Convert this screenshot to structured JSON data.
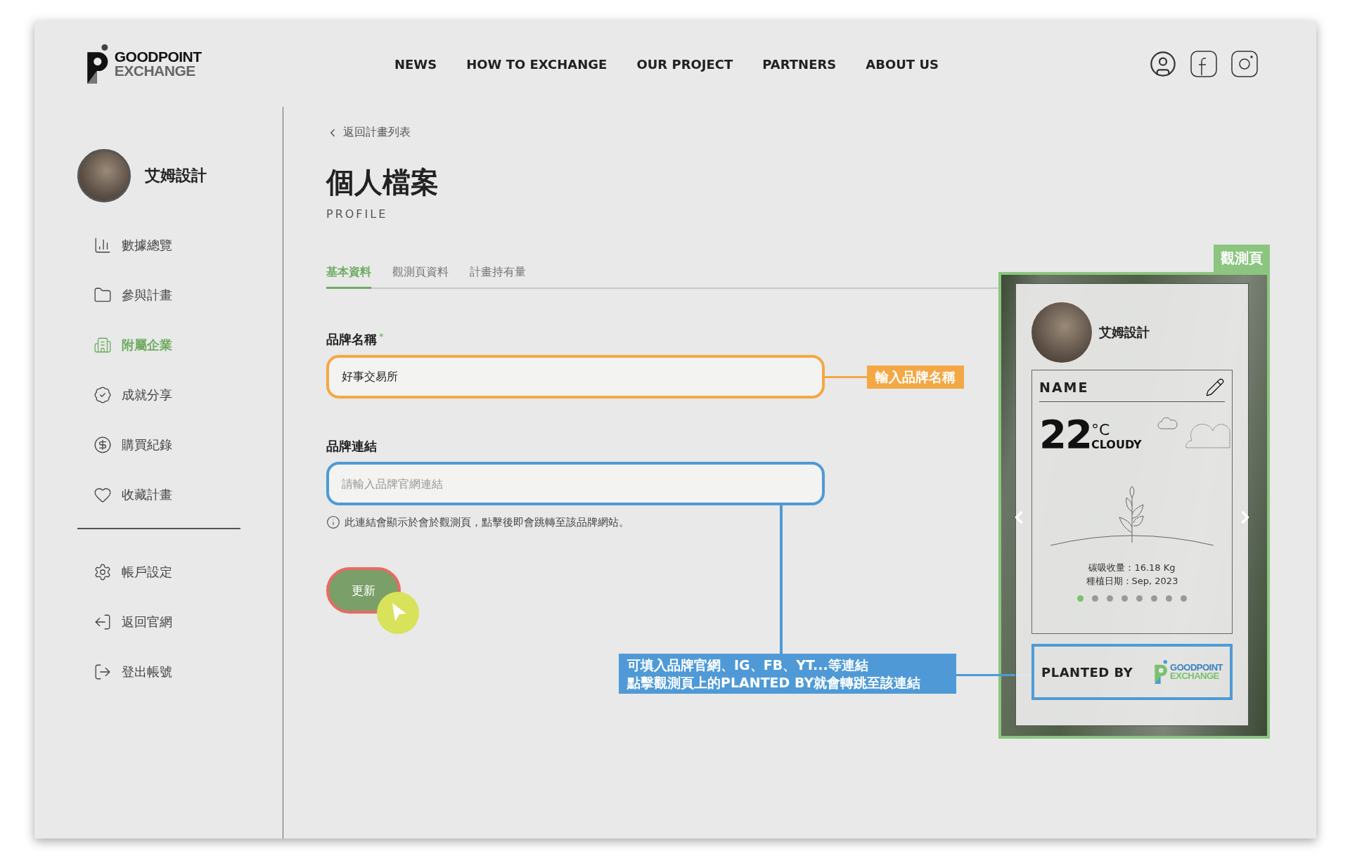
{
  "logo": {
    "line1": "GOODPOINT",
    "line2": "EXCHANGE"
  },
  "nav": [
    "NEWS",
    "HOW TO EXCHANGE",
    "OUR PROJECT",
    "PARTNERS",
    "ABOUT US"
  ],
  "sidebar": {
    "user_name": "艾姆設計",
    "items": [
      {
        "label": "數據總覽",
        "selected": false
      },
      {
        "label": "參與計畫",
        "selected": false
      },
      {
        "label": "附屬企業",
        "selected": true
      },
      {
        "label": "成就分享",
        "selected": false
      },
      {
        "label": "購買紀錄",
        "selected": false
      },
      {
        "label": "收藏計畫",
        "selected": false
      }
    ],
    "account_items": [
      {
        "label": "帳戶設定"
      },
      {
        "label": "返回官網"
      },
      {
        "label": "登出帳號"
      }
    ]
  },
  "back_link": "返回計畫列表",
  "page_title": "個人檔案",
  "page_subtitle": "PROFILE",
  "tabs": [
    {
      "label": "基本資料",
      "selected": true
    },
    {
      "label": "觀測頁資料",
      "selected": false
    },
    {
      "label": "計畫持有量",
      "selected": false
    }
  ],
  "fields": [
    {
      "label": "品牌名稱",
      "required_mark": "*",
      "value": "好事交易所",
      "color": "#f3a845"
    },
    {
      "label": "品牌連結",
      "placeholder": "請輸入品牌官網連結",
      "hint": "此連結會顯示於會於觀測頁，點擊後即會跳轉至該品牌網站。",
      "color": "#4f9ad6"
    }
  ],
  "submit": "更新",
  "annotations": [
    {
      "kind": "name",
      "color": "#f3a845",
      "lines": [
        "輸入品牌名稱"
      ]
    },
    {
      "kind": "link",
      "color": "#4f9ad6",
      "lines": [
        "可填入品牌官網、IG、FB、YT...等連結",
        "點擊觀測頁上的PLANTED BY就會轉跳至該連結"
      ]
    }
  ],
  "preview": {
    "tag": "觀測頁",
    "user_name": "艾姆設計",
    "card_title": "NAME",
    "temperature": "22",
    "unit": "°C",
    "weather": "CLOUDY",
    "carbon": "碳吸收量：16.18 Kg",
    "planted_date": "種植日期：Sep, 2023",
    "dots": [
      {
        "selected": true
      },
      {
        "selected": false
      },
      {
        "selected": false
      },
      {
        "selected": false
      },
      {
        "selected": false
      },
      {
        "selected": false
      },
      {
        "selected": false
      },
      {
        "selected": false
      }
    ],
    "planted_by": "PLANTED BY",
    "logo": {
      "line1": "GOODPOINT",
      "line2": "EXCHANGE"
    }
  }
}
